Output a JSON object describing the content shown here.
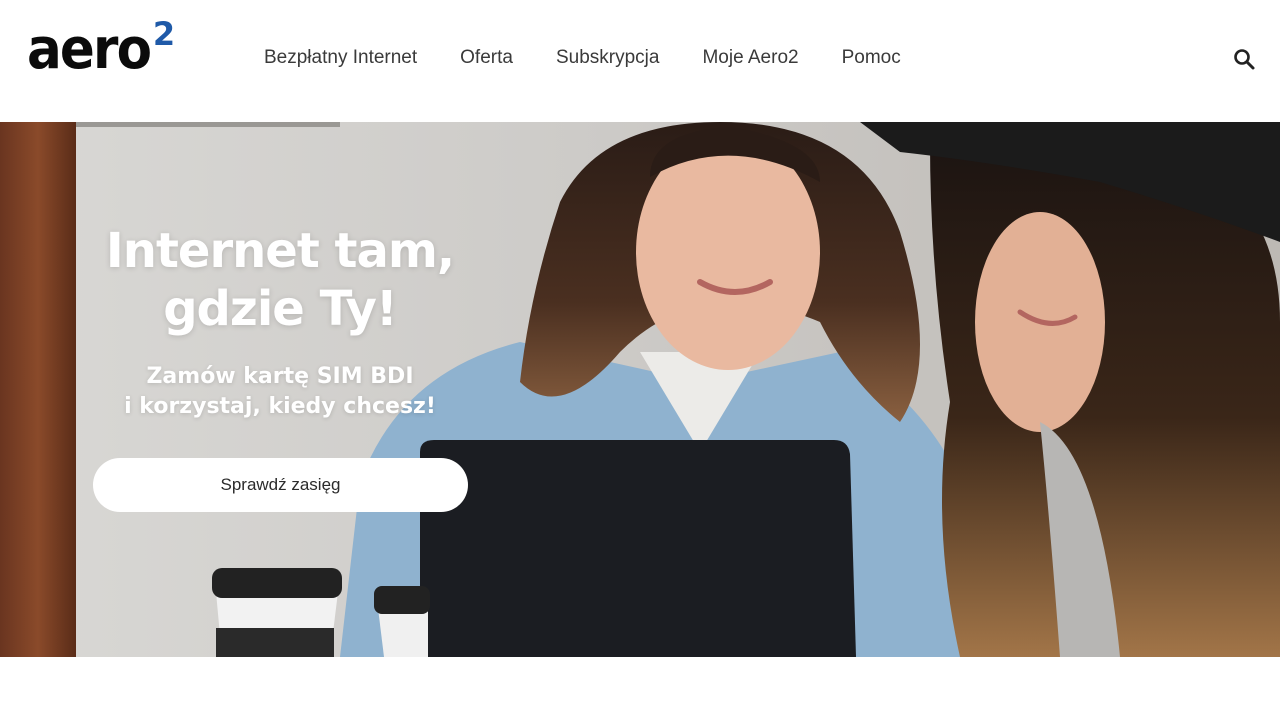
{
  "header": {
    "logo_text": "aero",
    "logo_sup": "2",
    "nav": [
      {
        "label": "Bezpłatny Internet"
      },
      {
        "label": "Oferta"
      },
      {
        "label": "Subskrypcja"
      },
      {
        "label": "Moje Aero2"
      },
      {
        "label": "Pomoc"
      }
    ],
    "search_icon": "search-icon"
  },
  "hero": {
    "title_line1": "Internet tam,",
    "title_line2": "gdzie Ty!",
    "subtitle_line1": "Zamów kartę SIM BDI",
    "subtitle_line2": "i korzystaj, kiedy chcesz!",
    "button_label": "Sprawdź zasięg"
  },
  "colors": {
    "brand_blue": "#1f5aa8",
    "text_dark": "#3a3a3a",
    "button_bg": "#ffffff"
  }
}
